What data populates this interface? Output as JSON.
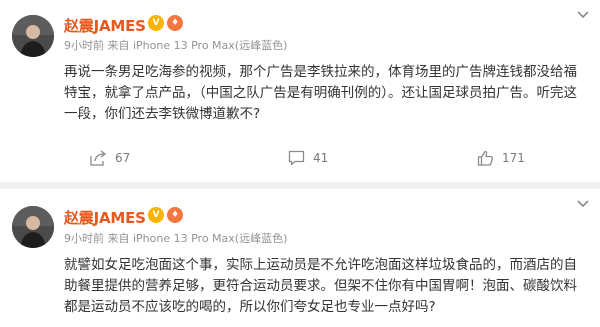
{
  "posts": [
    {
      "author": "赵震JAMES",
      "meta": "9小时前 来自 iPhone 13 Pro Max(远峰蓝色)",
      "body": "再说一条男足吃海参的视频，那个广告是李铁拉来的，体育场里的广告牌连钱都没给福特宝，就拿了点产品，（中国之队广告是有明确刊例的）。还让国足球员拍广告。听完这一段，你们还去李铁微博道歉不?",
      "shares": "67",
      "comments": "41",
      "likes": "171"
    },
    {
      "author": "赵震JAMES",
      "meta": "9小时前 来自 iPhone 13 Pro Max(远峰蓝色)",
      "body": "就譬如女足吃泡面这个事，实际上运动员是不允许吃泡面这样垃圾食品的，而酒店的自助餐里提供的营养足够，更符合运动员要求。但架不住你有中国胃啊！泡面、碳酸饮料都是运动员不应该吃的喝的，所以你们夸女足也专业一点好吗?"
    }
  ],
  "colors": {
    "name": "#e8581d",
    "meta": "#939393",
    "background": "#f1f1f1"
  },
  "icons": [
    "avatar",
    "verified-badge",
    "fire-badge",
    "chevron-down-icon",
    "share-icon",
    "comment-icon",
    "like-icon"
  ]
}
